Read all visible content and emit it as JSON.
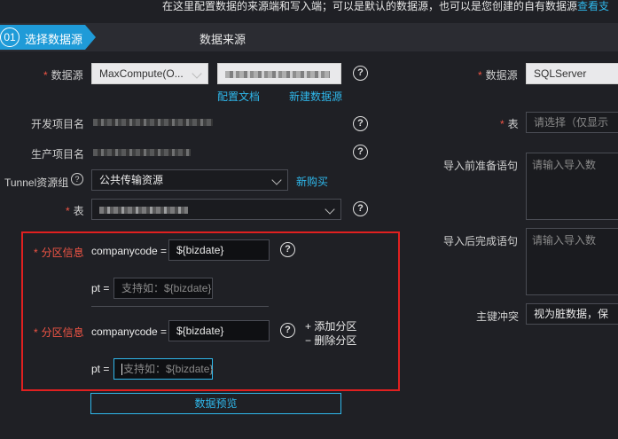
{
  "top_note": {
    "text": "在这里配置数据的来源端和写入端；可以是默认的数据源，也可以是您创建的自有数据源",
    "link": "查看支"
  },
  "steps": {
    "step_number": "01",
    "step_label": "选择数据源",
    "section_title": "数据来源"
  },
  "source": {
    "datasource_label": "数据源",
    "datasource_type": "MaxCompute(O...",
    "config_doc_link": "配置文档",
    "new_datasource_link": "新建数据源",
    "dev_project_label": "开发项目名",
    "prod_project_label": "生产项目名",
    "tunnel_label": "Tunnel资源组",
    "tunnel_value": "公共传输资源",
    "buy_link": "新购买",
    "table_label": "表",
    "partition_label": "分区信息",
    "partition1": {
      "key": "companycode =",
      "value": "${bizdate}",
      "sub_key": "pt =",
      "sub_placeholder": "支持如：${bizdate}"
    },
    "partition2": {
      "key": "companycode =",
      "value": "${bizdate}",
      "sub_key": "pt =",
      "sub_placeholder": "支持如：${bizdate}"
    },
    "add_partition": "+ 添加分区",
    "remove_partition": "− 删除分区",
    "preview_button": "数据预览"
  },
  "target": {
    "datasource_label": "数据源",
    "datasource_value": "SQLServer",
    "table_label": "表",
    "table_placeholder": "请选择（仅显示",
    "pre_sql_label": "导入前准备语句",
    "pre_sql_placeholder": "请输入导入数",
    "post_sql_label": "导入后完成语句",
    "post_sql_placeholder": "请输入导入数",
    "pk_conflict_label": "主键冲突",
    "pk_conflict_value": "视为脏数据，保"
  },
  "colors": {
    "accent": "#1f9bd8",
    "link": "#2fb8ec",
    "required": "#f25545",
    "highlight_box": "#e02020"
  }
}
